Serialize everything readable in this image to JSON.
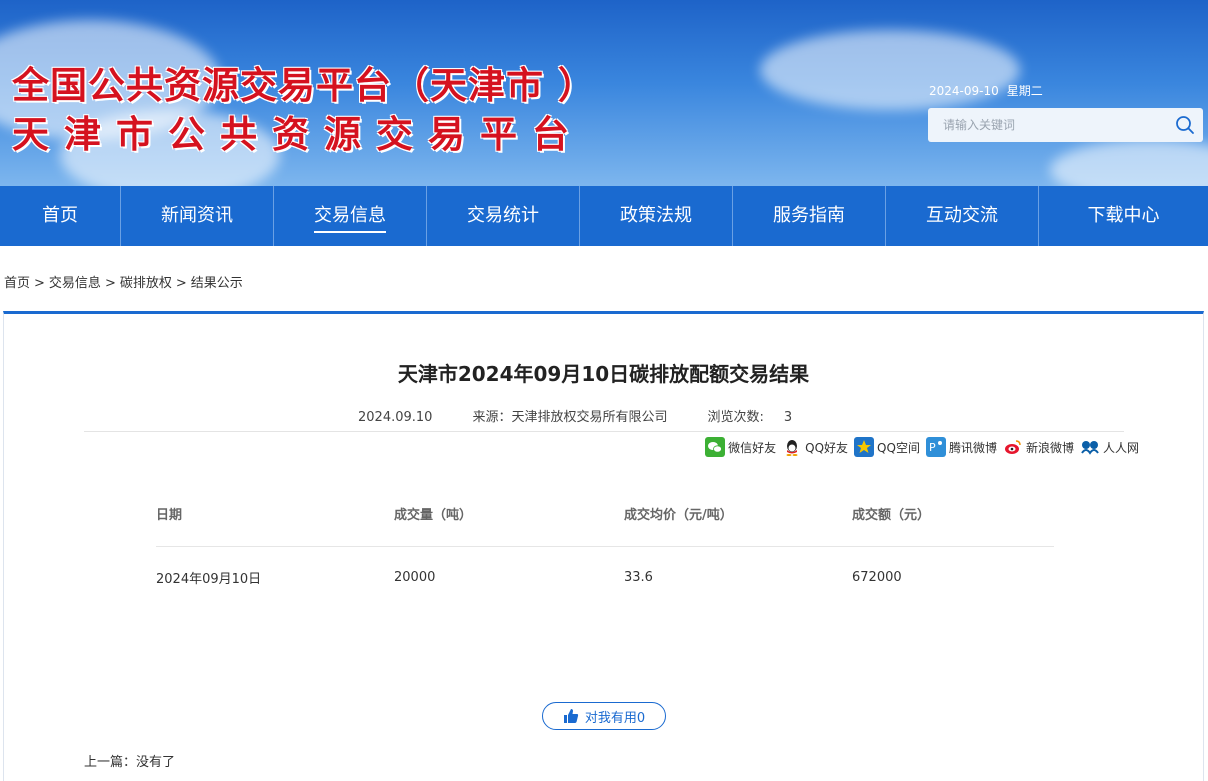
{
  "header": {
    "title_line1": "全国公共资源交易平台（天津市 ）",
    "title_line2": "天津市公共资源交易平台",
    "date": "2024-09-10",
    "weekday": "星期二",
    "search_placeholder": "请输入关键词",
    "search_icon": "search-icon"
  },
  "nav": {
    "items": [
      "首页",
      "新闻资讯",
      "交易信息",
      "交易统计",
      "政策法规",
      "服务指南",
      "互动交流",
      "下载中心"
    ],
    "active": "交易信息",
    "bg_color": "#1a6ad0"
  },
  "breadcrumb": {
    "items": [
      "首页",
      "交易信息",
      "碳排放权",
      "结果公示"
    ]
  },
  "article": {
    "title": "天津市2024年09月10日碳排放配额交易结果",
    "date": "2024.09.10",
    "source_label": "来源：",
    "source": "天津排放权交易所有限公司",
    "views_label": "浏览次数:",
    "views": "3"
  },
  "share": {
    "items": [
      {
        "label": "微信好友",
        "icon": "wechat-icon"
      },
      {
        "label": "QQ好友",
        "icon": "qq-icon"
      },
      {
        "label": "QQ空间",
        "icon": "qzone-icon"
      },
      {
        "label": "腾讯微博",
        "icon": "tencent-weibo-icon"
      },
      {
        "label": "新浪微博",
        "icon": "sina-weibo-icon"
      },
      {
        "label": "人人网",
        "icon": "renren-icon"
      }
    ]
  },
  "table": {
    "headers": [
      "日期",
      "成交量（吨）",
      "成交均价（元/吨）",
      "成交额（元）"
    ],
    "rows": [
      [
        "2024年09月10日",
        "20000",
        "33.6",
        "672000"
      ]
    ]
  },
  "feedback": {
    "useful_label": "对我有用0"
  },
  "pager": {
    "prev_label": "上一篇：",
    "prev_value": "没有了"
  },
  "colors": {
    "accent": "#1a6ad0",
    "title_red": "#d5121f"
  }
}
